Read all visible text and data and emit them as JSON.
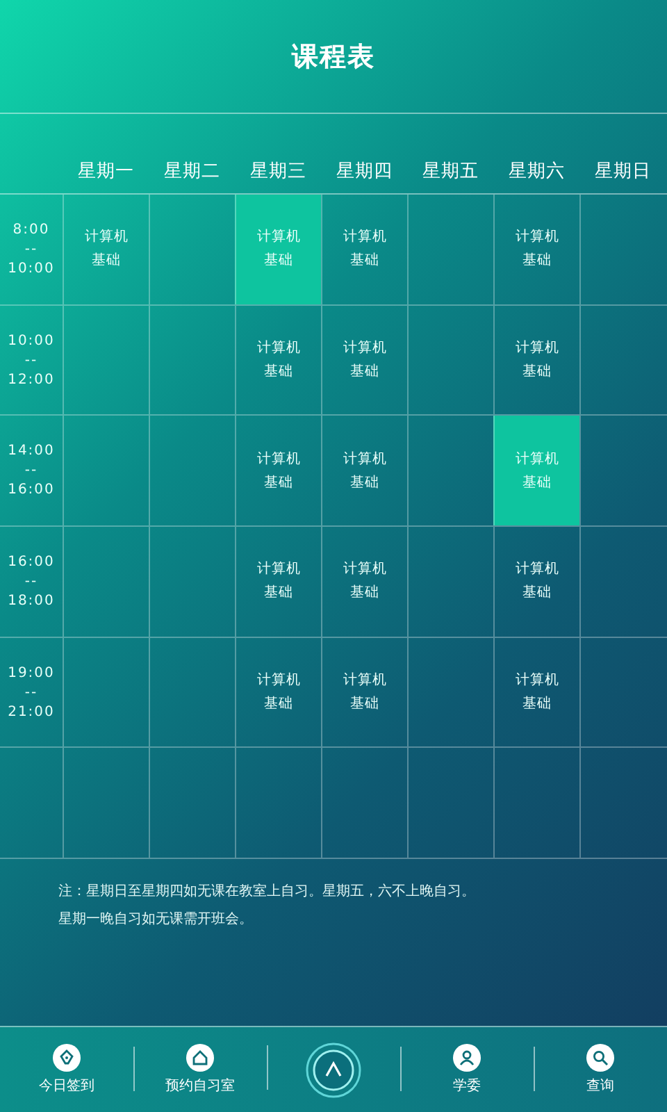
{
  "title": "课程表",
  "days": [
    "星期一",
    "星期二",
    "星期三",
    "星期四",
    "星期五",
    "星期六",
    "星期日"
  ],
  "rows": [
    {
      "start": "8:00",
      "dash": "--",
      "end": "10:00",
      "cells": [
        {
          "course": "计算机基础",
          "selected": false
        },
        {
          "selected": false
        },
        {
          "course": "计算机基础",
          "selected": true
        },
        {
          "course": "计算机基础",
          "selected": false
        },
        {
          "selected": false
        },
        {
          "course": "计算机基础",
          "selected": false
        },
        {
          "selected": false
        }
      ]
    },
    {
      "start": "10:00",
      "dash": "--",
      "end": "12:00",
      "cells": [
        {
          "selected": false
        },
        {
          "selected": false
        },
        {
          "course": "计算机基础",
          "selected": false
        },
        {
          "course": "计算机基础",
          "selected": false
        },
        {
          "selected": false
        },
        {
          "course": "计算机基础",
          "selected": false
        },
        {
          "selected": false
        }
      ]
    },
    {
      "start": "14:00",
      "dash": "--",
      "end": "16:00",
      "cells": [
        {
          "selected": false
        },
        {
          "selected": false
        },
        {
          "course": "计算机基础",
          "selected": false
        },
        {
          "course": "计算机基础",
          "selected": false
        },
        {
          "selected": false
        },
        {
          "course": "计算机基础",
          "selected": true
        },
        {
          "selected": false
        }
      ]
    },
    {
      "start": "16:00",
      "dash": "--",
      "end": "18:00",
      "cells": [
        {
          "selected": false
        },
        {
          "selected": false
        },
        {
          "course": "计算机基础",
          "selected": false
        },
        {
          "course": "计算机基础",
          "selected": false
        },
        {
          "selected": false
        },
        {
          "course": "计算机基础",
          "selected": false
        },
        {
          "selected": false
        }
      ]
    },
    {
      "start": "19:00",
      "dash": "--",
      "end": "21:00",
      "cells": [
        {
          "selected": false
        },
        {
          "selected": false
        },
        {
          "course": "计算机基础",
          "selected": false
        },
        {
          "course": "计算机基础",
          "selected": false
        },
        {
          "selected": false
        },
        {
          "course": "计算机基础",
          "selected": false
        },
        {
          "selected": false
        }
      ]
    },
    {
      "cells": [
        {
          "selected": false
        },
        {
          "selected": false
        },
        {
          "selected": false
        },
        {
          "selected": false
        },
        {
          "selected": false
        },
        {
          "selected": false
        },
        {
          "selected": false
        }
      ]
    }
  ],
  "notes": [
    "注：星期日至星期四如无课在教室上自习。星期五，六不上晚自习。",
    "星期一晚自习如无课需开班会。"
  ],
  "nav": [
    {
      "kind": "pen",
      "label": "今日签到"
    },
    {
      "kind": "home",
      "label": "预约自习室"
    },
    {
      "kind": "center"
    },
    {
      "kind": "person",
      "label": "学委"
    },
    {
      "kind": "search",
      "label": "查询"
    }
  ]
}
